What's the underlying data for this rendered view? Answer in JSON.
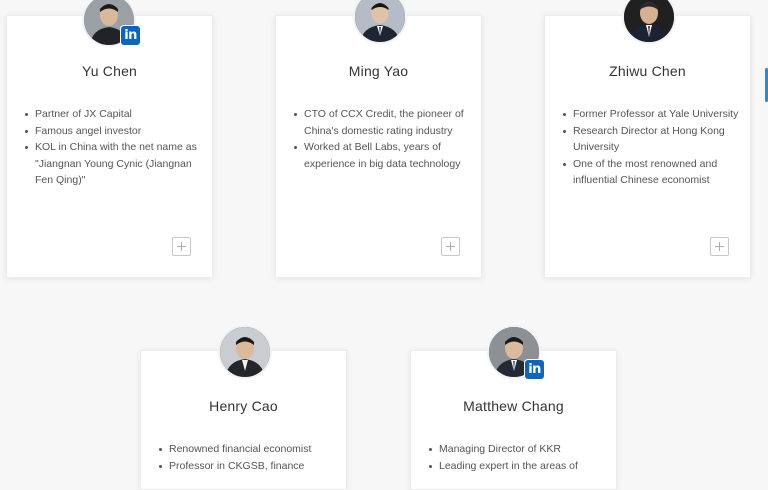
{
  "profiles": [
    {
      "name": "Yu Chen",
      "bullets": [
        "Partner of JX Capital",
        "Famous angel investor",
        "KOL in China with the net name as \"Jiangnan Young Cynic (Jiangnan Fen Qing)\""
      ],
      "linkedin_label": "in"
    },
    {
      "name": "Ming Yao",
      "bullets": [
        "CTO of CCX Credit, the pioneer of China's domestic rating industry",
        "Worked at Bell Labs, years of experience in big data technology"
      ]
    },
    {
      "name": "Zhiwu Chen",
      "bullets": [
        "Former Professor at Yale University",
        "Research Director at Hong Kong University",
        "One of the most renowned and influential Chinese economist"
      ]
    },
    {
      "name": "Henry Cao",
      "bullets": [
        "Renowned financial economist",
        "Professor in CKGSB, finance"
      ]
    },
    {
      "name": "Matthew Chang",
      "bullets": [
        "Managing Director of KKR",
        "Leading expert in the areas of"
      ],
      "linkedin_label": "in"
    }
  ],
  "colors": {
    "linkedin": "#0a66c2",
    "accent": "#2b8ad8",
    "background": "#f7f7f7",
    "card": "#ffffff"
  },
  "icons": {
    "linkedin": "linkedin-icon",
    "expand": "plus-icon"
  }
}
